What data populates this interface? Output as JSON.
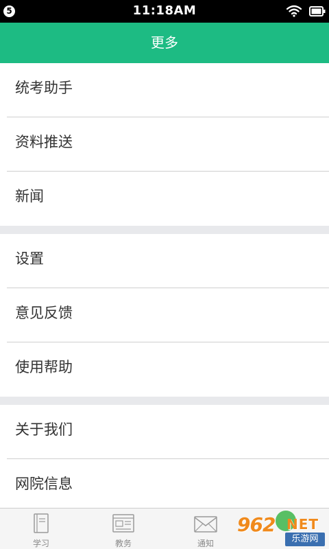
{
  "status_bar": {
    "badge": "5",
    "time": "11:18AM"
  },
  "title": "更多",
  "menu_groups": [
    {
      "items": [
        {
          "label": "统考助手"
        },
        {
          "label": "资料推送"
        },
        {
          "label": "新闻"
        }
      ]
    },
    {
      "items": [
        {
          "label": "设置"
        },
        {
          "label": "意见反馈"
        },
        {
          "label": "使用帮助"
        }
      ]
    },
    {
      "items": [
        {
          "label": "关于我们"
        },
        {
          "label": "网院信息"
        }
      ]
    }
  ],
  "tabs": [
    {
      "label": "学习",
      "icon": "book-icon"
    },
    {
      "label": "教务",
      "icon": "newspaper-icon"
    },
    {
      "label": "通知",
      "icon": "envelope-icon"
    },
    {
      "label": "",
      "icon": "more-icon"
    }
  ],
  "watermark": {
    "main": "962",
    "suffix": "NET",
    "sub": "乐游网"
  },
  "colors": {
    "header": "#1dbb83",
    "status_bar": "#000000",
    "divider": "#cfcfcf",
    "group_gap": "#e8e9ec",
    "tab_bar": "#f5f5f5"
  }
}
